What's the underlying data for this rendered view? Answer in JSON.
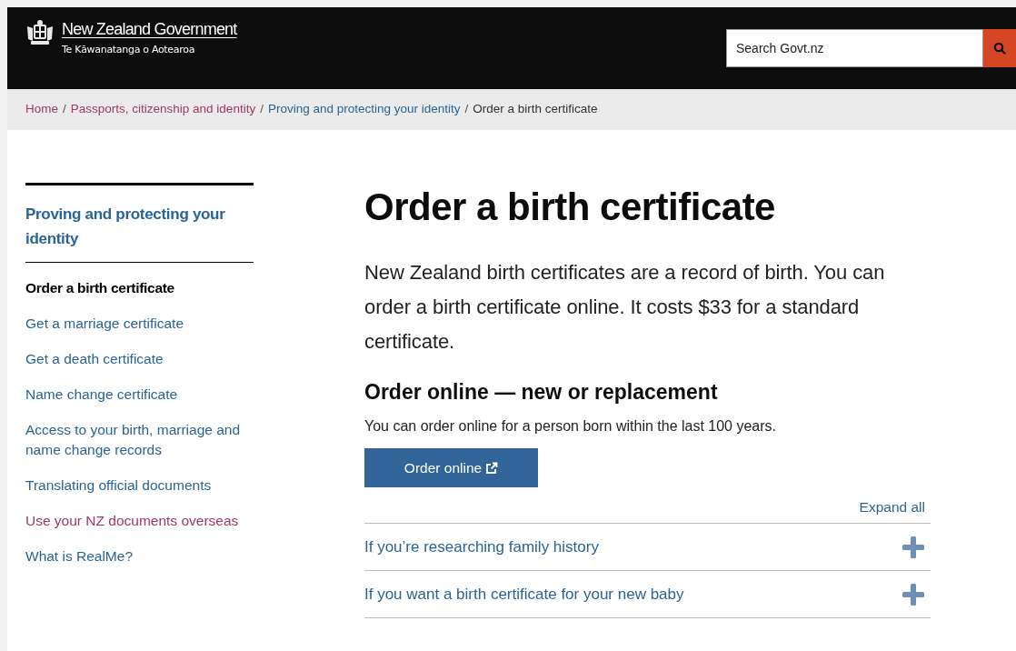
{
  "header": {
    "logo_title": "New Zealand Government",
    "logo_subtitle": "Te Kāwanatanga o Aotearoa",
    "search": {
      "placeholder": "Search Govt.nz"
    }
  },
  "breadcrumb": {
    "separator": "/",
    "items": [
      {
        "label": "Home",
        "current": false,
        "visited": true
      },
      {
        "label": "Passports, citizenship and identity",
        "current": false,
        "visited": true
      },
      {
        "label": "Proving and protecting your identity",
        "current": false,
        "visited": false
      },
      {
        "label": "Order a birth certificate",
        "current": true
      }
    ]
  },
  "sidebar": {
    "title": "Proving and protecting your identity",
    "items": [
      {
        "label": "Order a birth certificate",
        "selected": true
      },
      {
        "label": "Get a marriage certificate",
        "selected": false,
        "visited": false
      },
      {
        "label": "Get a death certificate",
        "selected": false,
        "visited": false
      },
      {
        "label": "Name change certificate",
        "selected": false,
        "visited": false
      },
      {
        "label": "Access to your birth, marriage and name change records",
        "selected": false,
        "visited": false
      },
      {
        "label": "Translating official documents",
        "selected": false,
        "visited": false
      },
      {
        "label": "Use your NZ documents overseas",
        "selected": false,
        "visited": true
      },
      {
        "label": "What is RealMe?",
        "selected": false,
        "visited": false
      }
    ]
  },
  "main": {
    "title": "Order a birth certificate",
    "intro": "New Zealand birth certificates are a record of birth. You can order a birth certificate online. It costs $33 for a standard certificate.",
    "section_title": "Order online — new or replacement",
    "section_text": "You can order online for a person born within the last 100 years.",
    "button": "Order online",
    "expand_all": "Expand all",
    "accordion": [
      {
        "label": "If you’re researching family history",
        "expanded": false
      },
      {
        "label": "If you want a birth certificate for your new baby",
        "expanded": false
      }
    ]
  }
}
